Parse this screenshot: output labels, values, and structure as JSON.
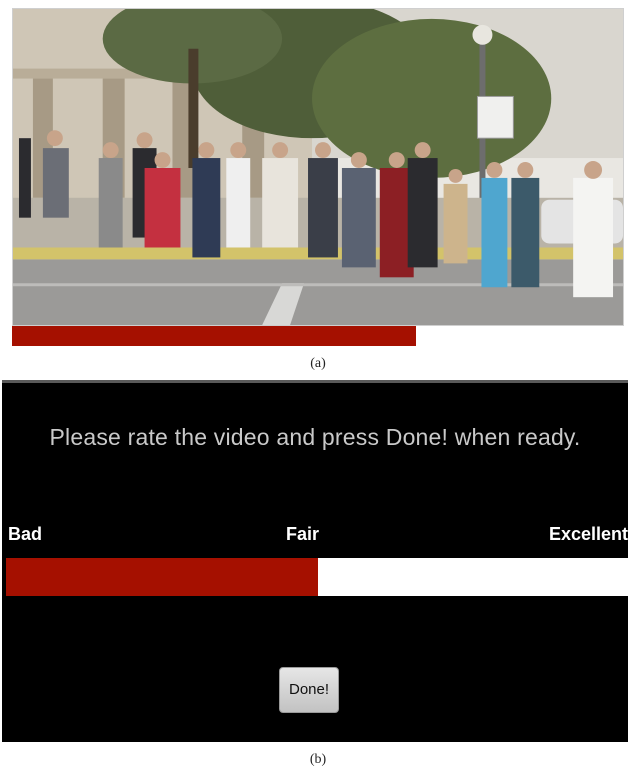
{
  "panel_a": {
    "video_frame": {
      "description_icon": "crowd-crossing-street-image"
    },
    "video_progress": {
      "fraction": 0.66,
      "color": "#a51000"
    },
    "caption": "(a)"
  },
  "panel_b": {
    "prompt": "Please rate the video and press Done! when ready.",
    "scale_labels": {
      "low": "Bad",
      "mid": "Fair",
      "high": "Excellent"
    },
    "rating": {
      "fraction": 0.5,
      "fill_color": "#a51000",
      "track_color": "#ffffff"
    },
    "done_button": "Done!",
    "caption": "(b)"
  }
}
